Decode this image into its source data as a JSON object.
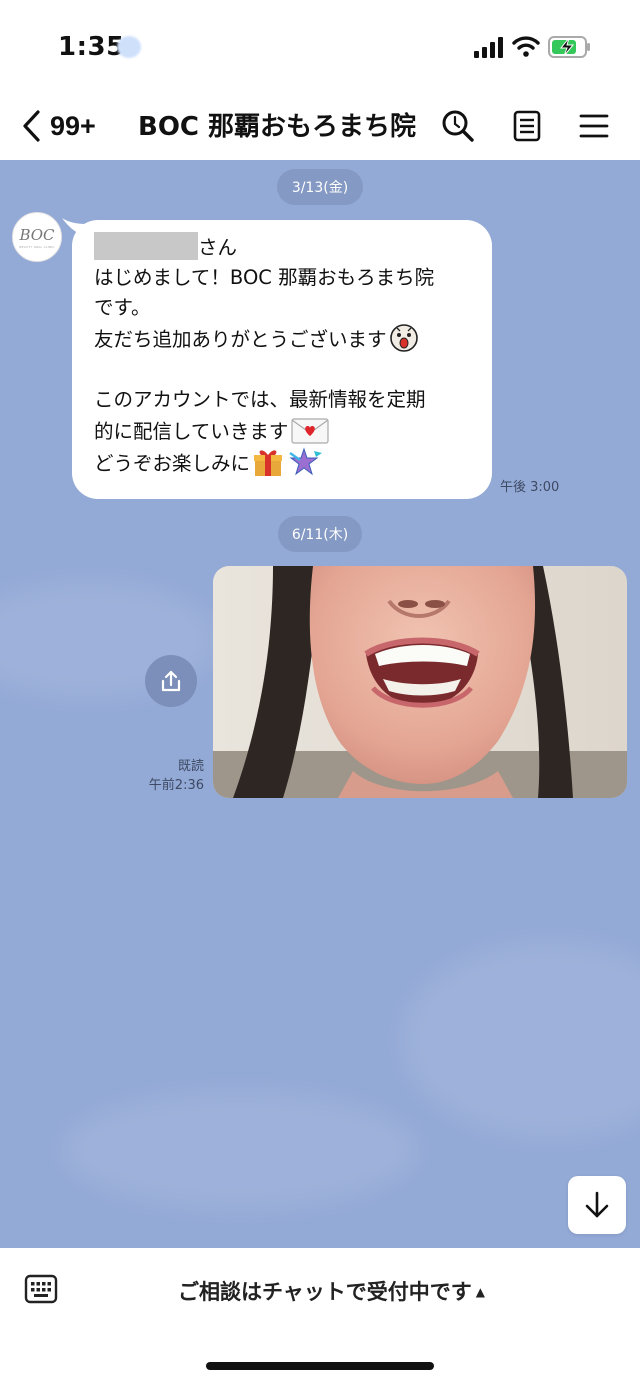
{
  "status_bar": {
    "time": "1:35",
    "icons": [
      "location-icon",
      "signal-icon",
      "wifi-icon",
      "battery-charging-icon"
    ]
  },
  "header": {
    "back_count": "99+",
    "title": "BOC 那覇おもろまち院",
    "icons": [
      "search-icon",
      "notes-icon",
      "menu-icon"
    ]
  },
  "chat": {
    "background_color": "#93a9d6",
    "date_1": "3/13(金)",
    "date_2": "6/11(木)",
    "avatar": {
      "monogram": "BOC",
      "caption": "BEAUTY ORAL CLINIC"
    },
    "message": {
      "line_1_suffix": "さん",
      "line_2": "はじめまして！BOC 那覇おもろまち院",
      "line_3": "です。",
      "line_4": "友だち追加ありがとうございます",
      "line_5": "このアカウントでは、最新情報を定期",
      "line_6": "的に配信していきます",
      "line_7": "どうぞお楽しみに",
      "time": "午後 3:00",
      "emojis": [
        "character-sticker-icon",
        "love-letter-icon",
        "gift-icon",
        "shooting-star-icon"
      ]
    },
    "photo_message": {
      "read_label": "既読",
      "time": "午前2:36"
    }
  },
  "bottom_bar": {
    "consult_text": "ご相談はチャットで受付中です",
    "caret": "▲"
  }
}
